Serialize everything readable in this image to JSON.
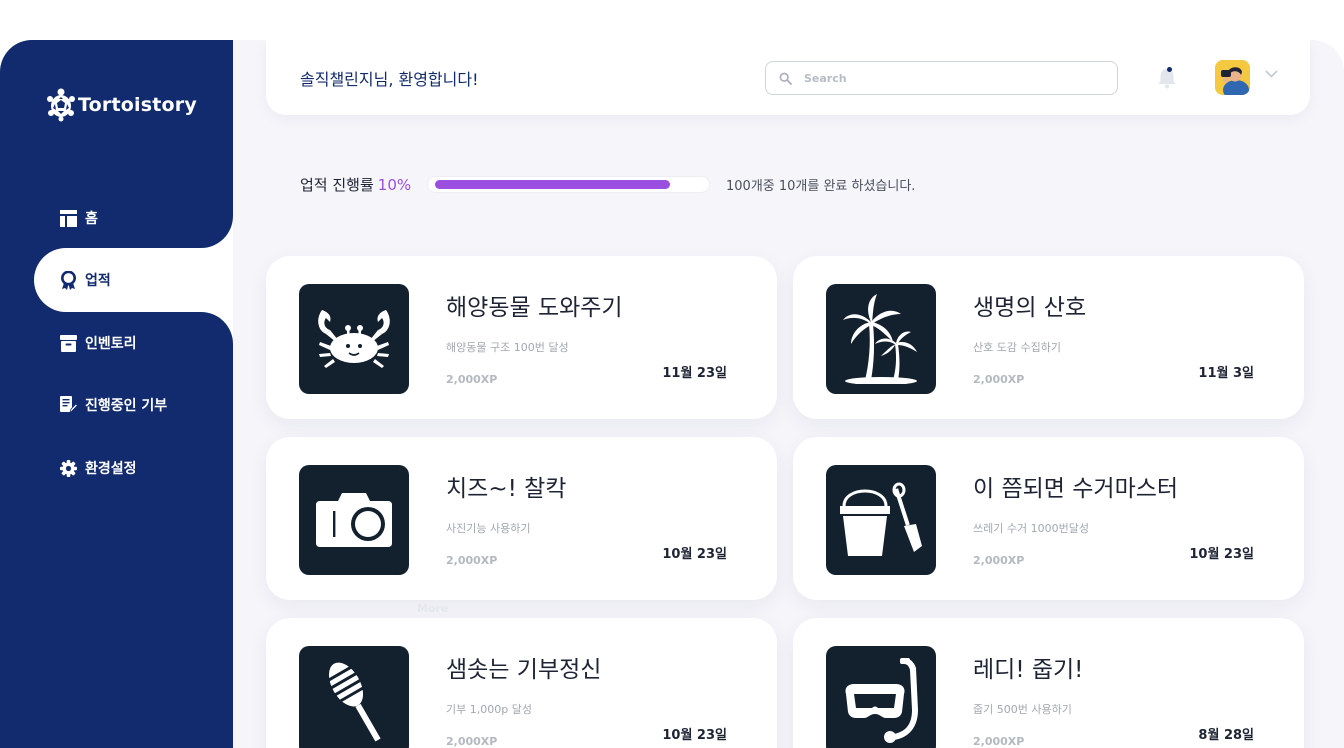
{
  "brand": {
    "name": "Tortoistory"
  },
  "sidebar": {
    "items": [
      {
        "label": "홈",
        "icon": "layout-icon",
        "active": false
      },
      {
        "label": "업적",
        "icon": "award-icon",
        "active": true
      },
      {
        "label": "인벤토리",
        "icon": "archive-icon",
        "active": false
      },
      {
        "label": "진행중인 기부",
        "icon": "document-edit-icon",
        "active": false
      },
      {
        "label": "환경설정",
        "icon": "gear-icon",
        "active": false
      }
    ]
  },
  "header": {
    "welcome": "솔직챌린지님, 환영합니다!",
    "search_placeholder": "Search"
  },
  "progress": {
    "label": "업적 진행률",
    "percent_text": "10%",
    "fraction": 0.88,
    "note": "100개중 10개를 완료 하셨습니다."
  },
  "ghost_text": "More",
  "cards": [
    {
      "title": "해양동물 도와주기",
      "desc": "해양동물 구조 100번 달성",
      "xp": "2,000XP",
      "date": "11월 23일",
      "icon": "crab-icon"
    },
    {
      "title": "생명의 산호",
      "desc": "산호 도감 수집하기",
      "xp": "2,000XP",
      "date": "11월 3일",
      "icon": "palm-tree-icon"
    },
    {
      "title": "치즈~! 찰칵",
      "desc": "사진기능 사용하기",
      "xp": "2,000XP",
      "date": "10월 23일",
      "icon": "camera-icon"
    },
    {
      "title": "이 쯤되면 수거마스터",
      "desc": "쓰레기 수거 1000번달성",
      "xp": "2,000XP",
      "date": "10월 23일",
      "icon": "bucket-shovel-icon"
    },
    {
      "title": "샘솟는 기부정신",
      "desc": "기부 1,000p 달성",
      "xp": "2,000XP",
      "date": "10월 23일",
      "icon": "microphone-icon"
    },
    {
      "title": "레디! 줍기!",
      "desc": "줍기 500번 사용하기",
      "xp": "2,000XP",
      "date": "8월 28일",
      "icon": "snorkel-mask-icon"
    }
  ]
}
